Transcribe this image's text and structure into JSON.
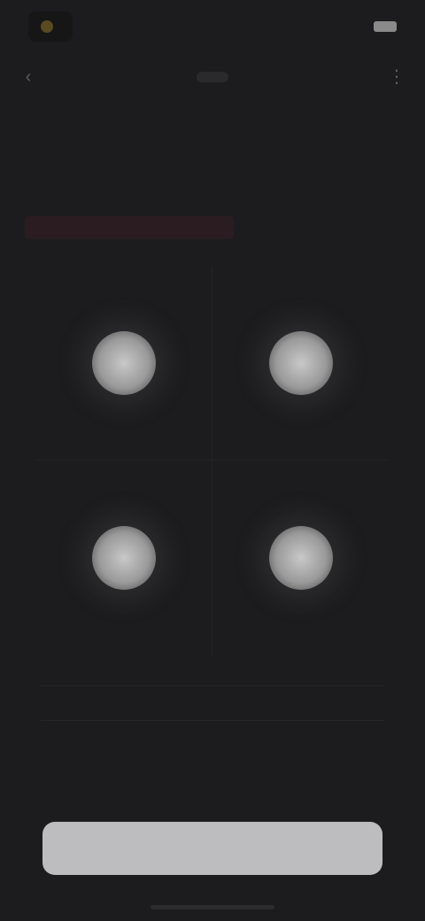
{
  "status_bar": {
    "time": "",
    "signal": ""
  },
  "nav": {
    "back_icon": "chevron-left-icon",
    "title": "",
    "more_icon": "more-icon"
  },
  "content": {
    "headline": "",
    "subline": "",
    "warning": ""
  },
  "options": [
    {
      "label": ""
    },
    {
      "label": ""
    },
    {
      "label": ""
    },
    {
      "label": ""
    }
  ],
  "info": {
    "text": "",
    "link": ""
  },
  "button": {
    "label": ""
  },
  "colors": {
    "background": "#1c1c1e",
    "warning": "#c23a4a",
    "button": "#bdbdc0"
  }
}
